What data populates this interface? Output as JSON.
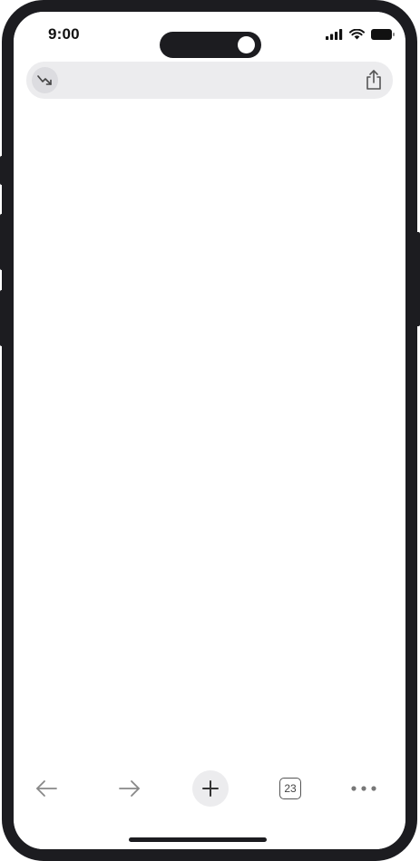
{
  "status_bar": {
    "time": "9:00"
  },
  "address_bar": {
    "left_icon": "trending-down-icon",
    "right_icon": "share-icon"
  },
  "toolbar": {
    "back_icon": "back-arrow-icon",
    "forward_icon": "forward-arrow-icon",
    "new_tab_icon": "plus-icon",
    "tab_count": "23",
    "more_icon": "more-dots-icon"
  },
  "colors": {
    "frame": "#1c1c20",
    "bar_background": "#ececee",
    "icon": "#555555"
  }
}
